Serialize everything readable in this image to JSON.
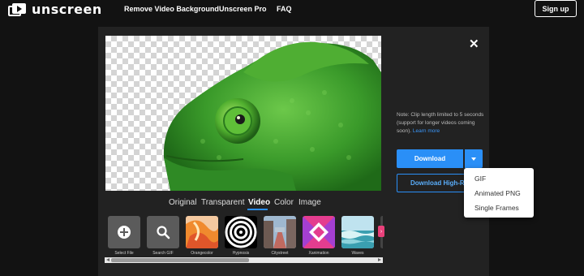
{
  "header": {
    "logo_text": "unscreen",
    "nav": [
      "Remove Video Background",
      "Unscreen Pro",
      "FAQ"
    ],
    "signup_label": "Sign up"
  },
  "modal": {
    "close_icon": "close-icon",
    "tabs": [
      "Original",
      "Transparent",
      "Video",
      "Color",
      "Image"
    ],
    "active_tab": "Video",
    "thumbnails": [
      {
        "label": "Select File",
        "icon": "plus-circle-icon"
      },
      {
        "label": "Search GIF",
        "icon": "search-icon"
      },
      {
        "label": "Orangecolor"
      },
      {
        "label": "Hypnosis"
      },
      {
        "label": "Citystreet"
      },
      {
        "label": "Xanimation"
      },
      {
        "label": "Waves"
      }
    ],
    "note_text": "Note: Clip length limited to 5 seconds (support for longer videos coming soon).",
    "note_link": "Learn more",
    "download_label": "Download",
    "download_hr_label": "Download High-Re",
    "dropdown_options": [
      "GIF",
      "Animated PNG",
      "Single Frames"
    ]
  },
  "colors": {
    "accent": "#2a8ff7",
    "background": "#121212",
    "panel": "#222222"
  }
}
